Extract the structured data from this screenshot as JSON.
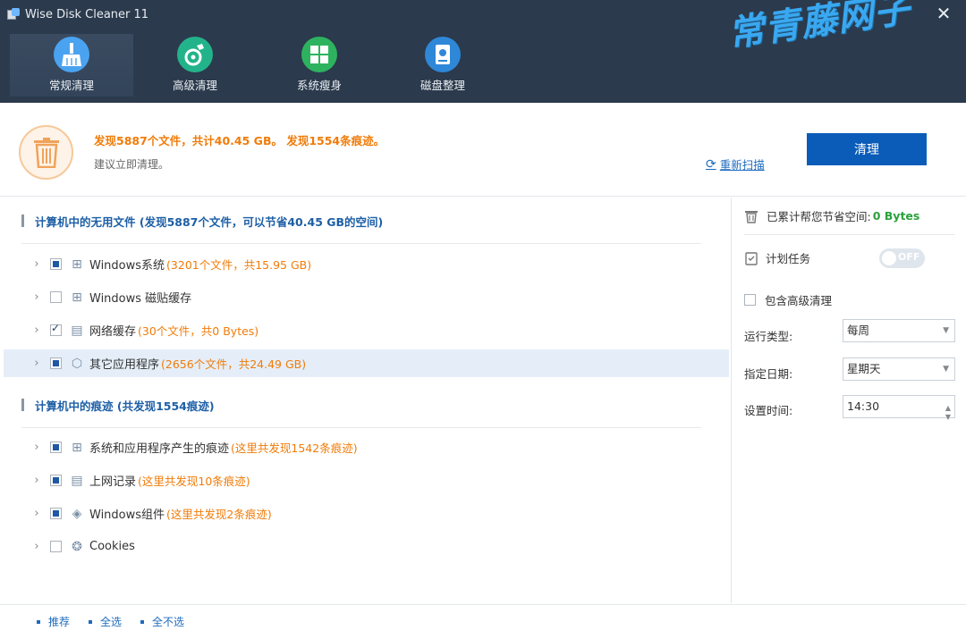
{
  "window": {
    "title": "Wise Disk Cleaner 11",
    "close_label": "✕"
  },
  "watermark": "常青藤网子",
  "nav": [
    {
      "label": "常规清理",
      "icon": "broom-icon",
      "color": "#4aa3f0"
    },
    {
      "label": "高级清理",
      "icon": "disk-clean-icon",
      "color": "#23b38a"
    },
    {
      "label": "系统瘦身",
      "icon": "windows-icon",
      "color": "#2db35f"
    },
    {
      "label": "磁盘整理",
      "icon": "defrag-icon",
      "color": "#2f87d8"
    }
  ],
  "summary": {
    "found": "发现5887个文件，共计40.45 GB。 发现1554条痕迹。",
    "suggest": "建议立即清理。",
    "rescan": "重新扫描",
    "clean_button": "清理"
  },
  "sections": [
    {
      "title": "计算机中的无用文件 (发现5887个文件，可以节省40.45 GB的空间)",
      "items": [
        {
          "name": "Windows系统",
          "count": "(3201个文件，共15.95 GB)",
          "state": "partial",
          "icon": "windows-grid-icon"
        },
        {
          "name": "Windows 磁贴缓存",
          "count": "",
          "state": "unchecked",
          "icon": "tiles-icon"
        },
        {
          "name": "网络缓存",
          "count": "(30个文件，共0 Bytes)",
          "state": "checked",
          "icon": "network-cache-icon"
        },
        {
          "name": "其它应用程序",
          "count": "(2656个文件，共24.49 GB)",
          "state": "partial",
          "icon": "cube-icon"
        }
      ]
    },
    {
      "title": "计算机中的痕迹 (共发现1554痕迹)",
      "items": [
        {
          "name": "系统和应用程序产生的痕迹",
          "count": "(这里共发现1542条痕迹)",
          "state": "partial",
          "icon": "windows-grid-icon"
        },
        {
          "name": "上网记录",
          "count": "(这里共发现10条痕迹)",
          "state": "partial",
          "icon": "browser-history-icon"
        },
        {
          "name": "Windows组件",
          "count": "(这里共发现2条痕迹)",
          "state": "partial",
          "icon": "puzzle-icon"
        },
        {
          "name": "Cookies",
          "count": "",
          "state": "unchecked",
          "icon": "cookie-icon"
        }
      ]
    }
  ],
  "right": {
    "saved_label": "已累计帮您节省空间:",
    "saved_value": "0 Bytes",
    "schedule_label": "计划任务",
    "toggle_label": "OFF",
    "include_advanced": "包含高级清理",
    "run_type_label": "运行类型:",
    "run_type_value": "每周",
    "date_label": "指定日期:",
    "date_value": "星期天",
    "time_label": "设置时间:",
    "time_value": "14:30"
  },
  "footer": {
    "recommend": "推荐",
    "select_all": "全选",
    "select_none": "全不选"
  }
}
